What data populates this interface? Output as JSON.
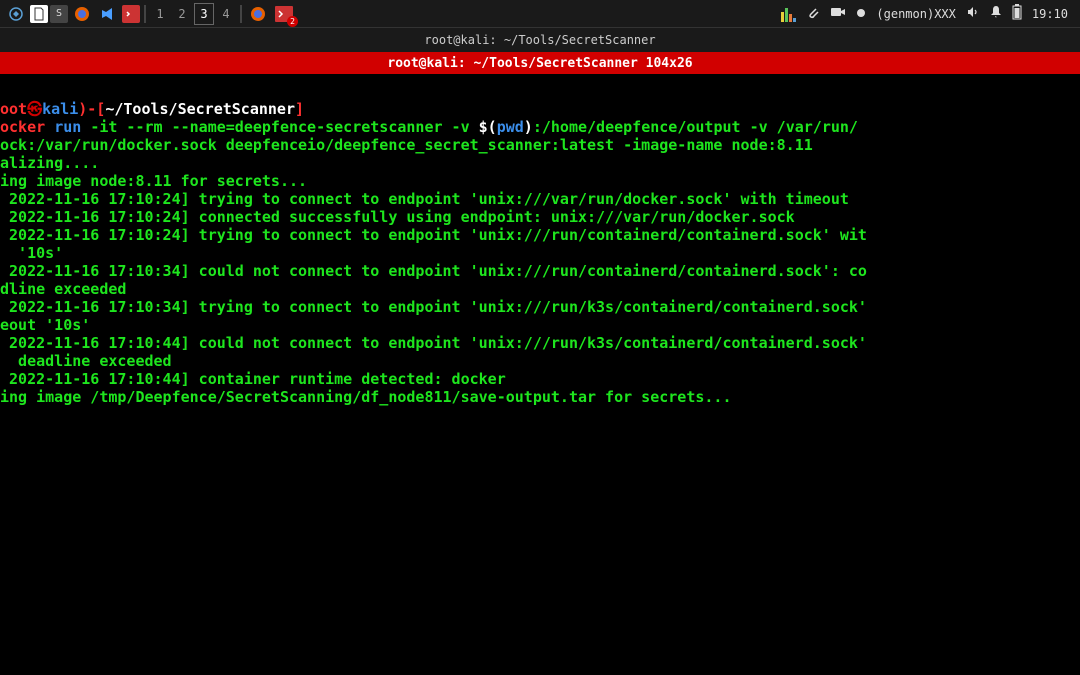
{
  "taskbar": {
    "workspaces": [
      "1",
      "2",
      "3",
      "4"
    ],
    "active_workspace": "3",
    "badge_count": "2",
    "right": {
      "genmon": "(genmon)XXX",
      "time": "19:10"
    }
  },
  "window": {
    "title": "root@kali: ~/Tools/SecretScanner",
    "dimension_bar": "root@kali: ~/Tools/SecretScanner 104x26"
  },
  "prompt": {
    "user_part": "oot",
    "dragon": "㉿",
    "host": "kali",
    "close_paren": ")-[",
    "tilde": "~",
    "path": "/Tools/SecretScanner",
    "end_bracket": "]"
  },
  "cmd": {
    "l1_docker": "ocker ",
    "l1_run": "run ",
    "l1_flags": "-it --rm --name=deepfence-secretscanner -v ",
    "l1_pwd_open": "$(",
    "l1_pwd": "pwd",
    "l1_pwd_close": ")",
    "l1_after": ":/home/deepfence/output -v /var/run/",
    "l2": "ock:/var/run/docker.sock deepfenceio/deepfence_secret_scanner:latest -image-name node:8.11"
  },
  "output": {
    "l3": "alizing....",
    "l4": "ing image node:8.11 for secrets...",
    "l5": " 2022-11-16 17:10:24] trying to connect to endpoint 'unix:///var/run/docker.sock' with timeout",
    "l6": "",
    "l7": " 2022-11-16 17:10:24] connected successfully using endpoint: unix:///var/run/docker.sock",
    "l8": " 2022-11-16 17:10:24] trying to connect to endpoint 'unix:///run/containerd/containerd.sock' wit",
    "l9": "  '10s'",
    "l10": " 2022-11-16 17:10:34] could not connect to endpoint 'unix:///run/containerd/containerd.sock': co",
    "l11": "dline exceeded",
    "l12": " 2022-11-16 17:10:34] trying to connect to endpoint 'unix:///run/k3s/containerd/containerd.sock'",
    "l13": "eout '10s'",
    "l14": " 2022-11-16 17:10:44] could not connect to endpoint 'unix:///run/k3s/containerd/containerd.sock'",
    "l15": "  deadline exceeded",
    "l16": " 2022-11-16 17:10:44] container runtime detected: docker",
    "l17": "ing image /tmp/Deepfence/SecretScanning/df_node811/save-output.tar for secrets..."
  }
}
